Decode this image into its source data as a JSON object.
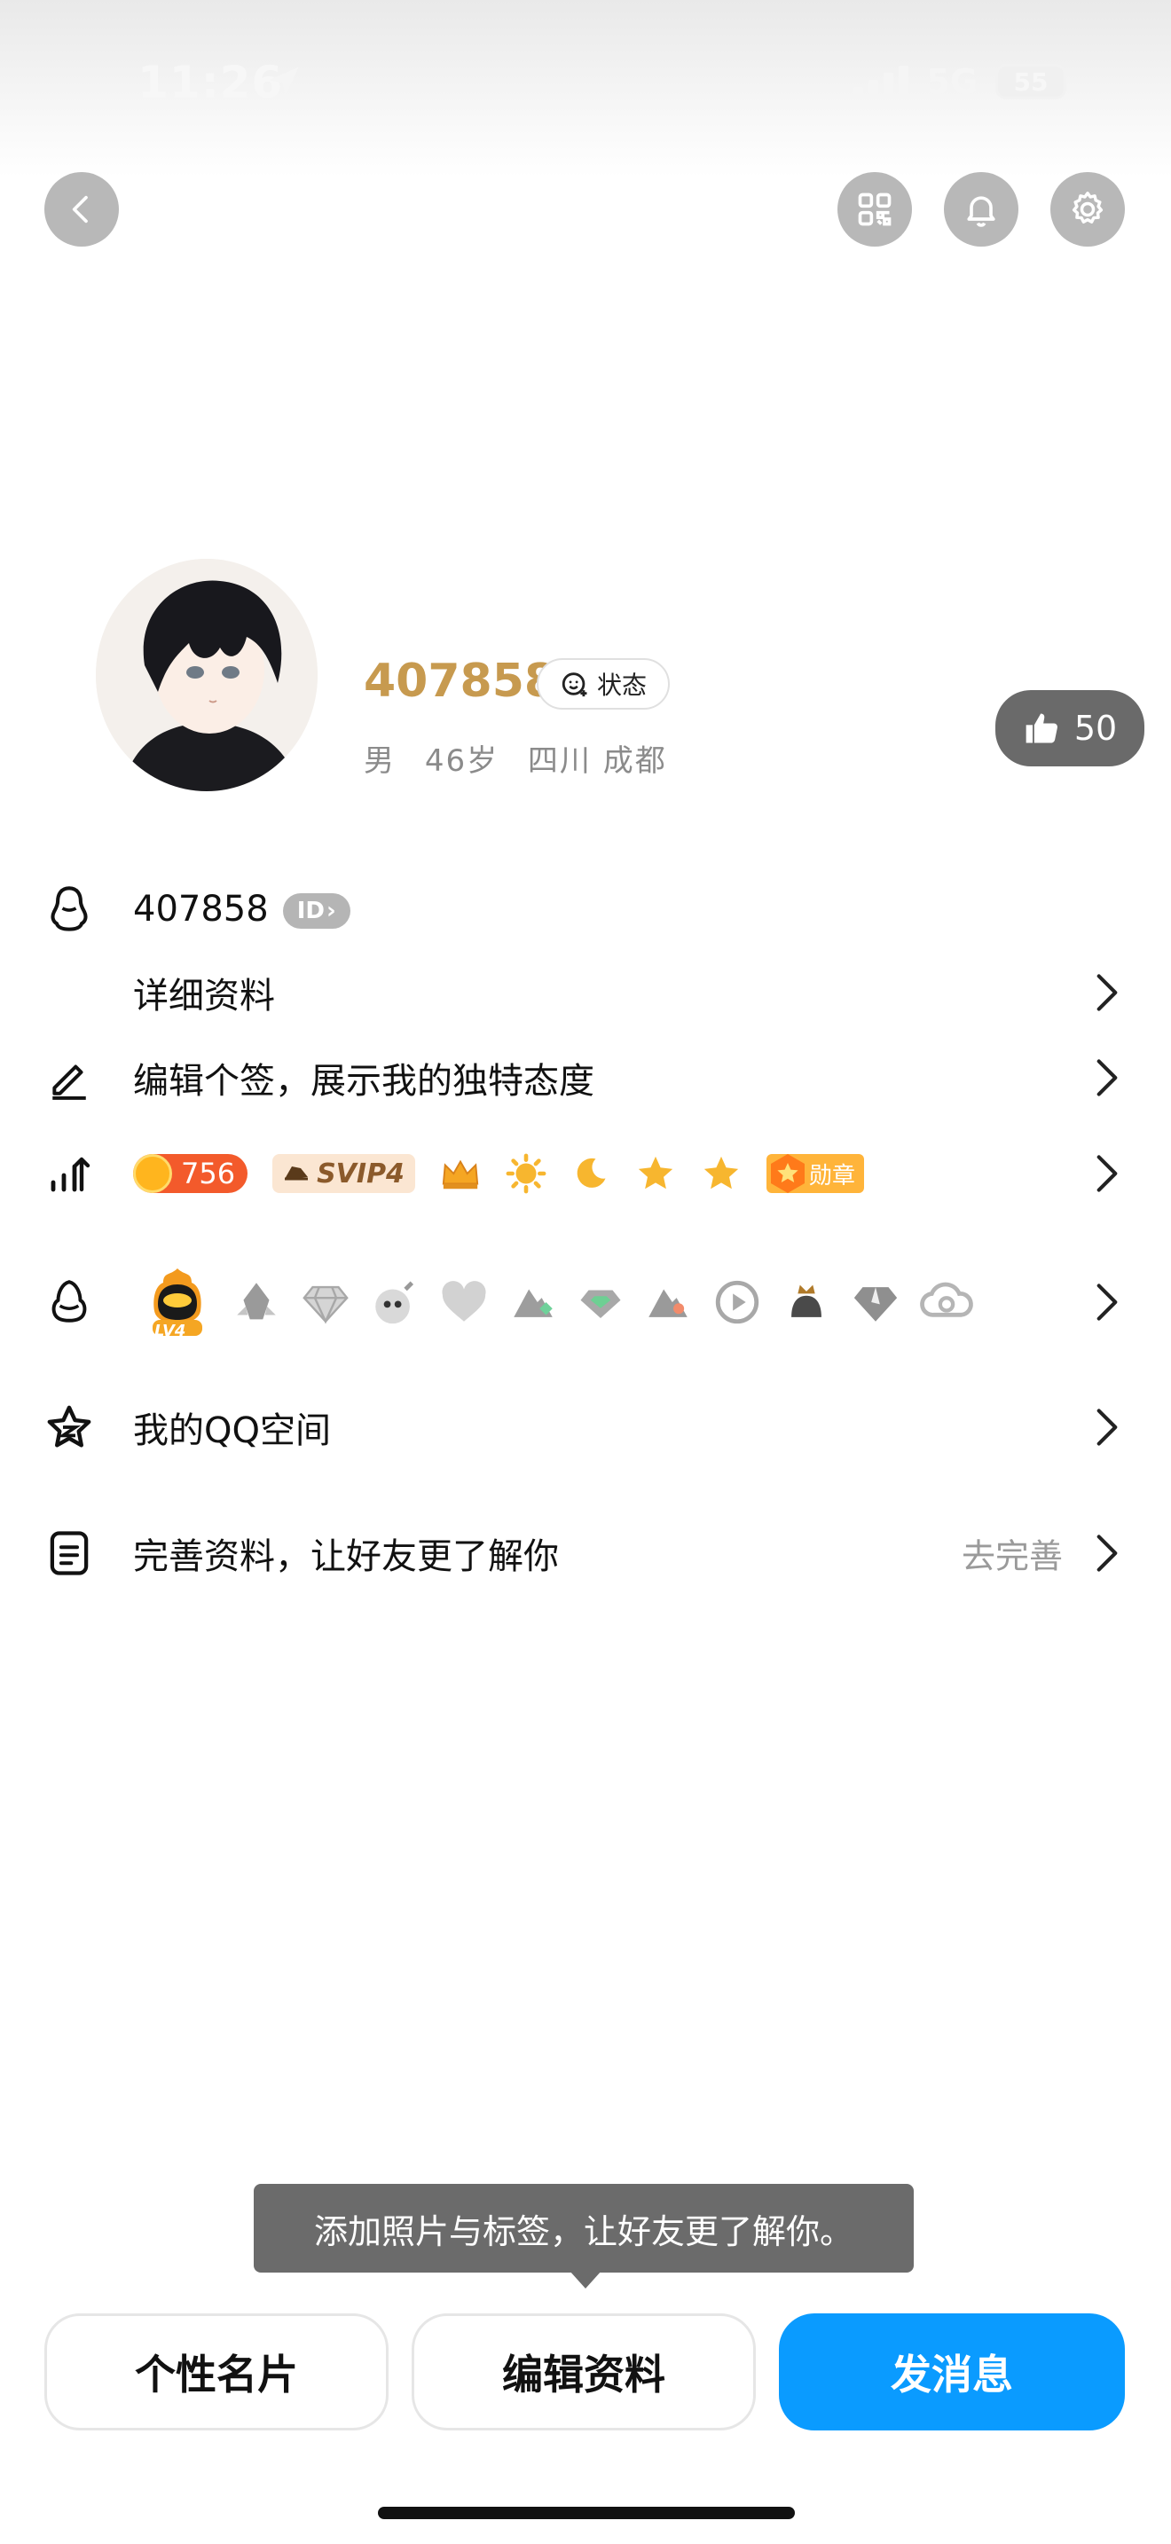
{
  "status_bar": {
    "time": "11:26",
    "network": "5G",
    "battery": "55"
  },
  "header": {
    "icons": [
      "back-icon",
      "qr-code-icon",
      "bell-icon",
      "settings-gear-icon"
    ]
  },
  "profile": {
    "nickname": "407858",
    "status_label": "状态",
    "gender": "男",
    "age": "46岁",
    "location": "四川 成都",
    "likes": "50"
  },
  "rows": {
    "qq_number": "407858",
    "id_badge": "ID",
    "detail": "详细资料",
    "signature": "编辑个签，展示我的独特态度",
    "coin_count": "756",
    "svip": "SVIP4",
    "medal": "勋章",
    "lv_badge": "LV4",
    "qzone": "我的QQ空间",
    "complete": "完善资料，让好友更了解你",
    "complete_action": "去完善"
  },
  "tooltip": {
    "text": "添加照片与标签，让好友更了解你。"
  },
  "actions": {
    "card": "个性名片",
    "edit": "编辑资料",
    "message": "发消息"
  },
  "colors": {
    "nickname": "#c79a4f",
    "primary": "#0a9bff",
    "like_chip": "#6a6a6a",
    "coin_badge": "#f35a2b"
  }
}
